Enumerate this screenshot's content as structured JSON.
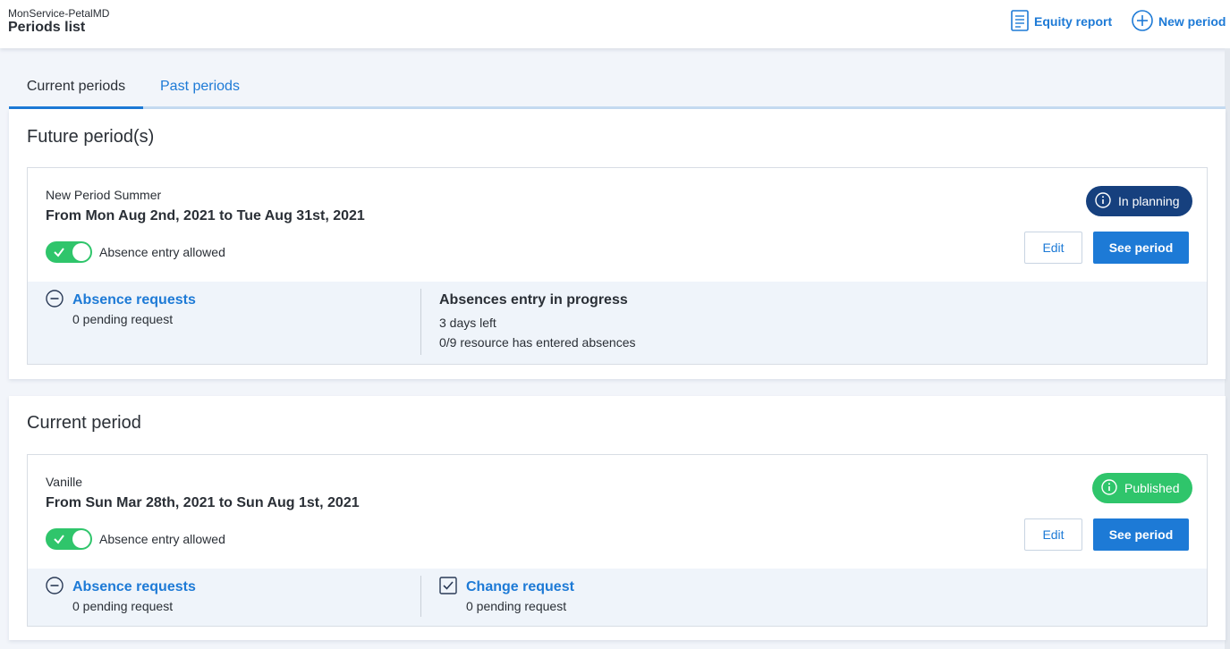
{
  "header": {
    "app_name": "MonService-PetalMD",
    "title": "Periods list",
    "equity_report_label": "Equity report",
    "new_period_label": "New period"
  },
  "tabs": [
    {
      "label": "Current periods",
      "active": true
    },
    {
      "label": "Past periods",
      "active": false
    }
  ],
  "future_section": {
    "title": "Future period(s)",
    "period": {
      "name": "New Period Summer",
      "dates": "From Mon Aug 2nd, 2021 to Tue Aug 31st, 2021",
      "toggle_label": "Absence entry allowed",
      "toggle_on": true,
      "status": "In planning",
      "status_color": "#16407e",
      "edit_label": "Edit",
      "see_label": "See period",
      "absence_requests_label": "Absence requests",
      "absence_requests_pending": "0 pending request",
      "progress_title": "Absences entry in progress",
      "days_left": "3 days left",
      "resources_entered": "0/9 resource has entered absences"
    }
  },
  "current_section": {
    "title": "Current period",
    "period": {
      "name": "Vanille",
      "dates": "From Sun Mar 28th, 2021 to Sun Aug 1st, 2021",
      "toggle_label": "Absence entry allowed",
      "toggle_on": true,
      "status": "Published",
      "status_color": "#2fc56b",
      "edit_label": "Edit",
      "see_label": "See period",
      "absence_requests_label": "Absence requests",
      "absence_requests_pending": "0 pending request",
      "change_request_label": "Change request",
      "change_request_pending": "0 pending request"
    }
  },
  "colors": {
    "accent": "#1d7ad6",
    "toggle_on": "#2fc56b"
  }
}
